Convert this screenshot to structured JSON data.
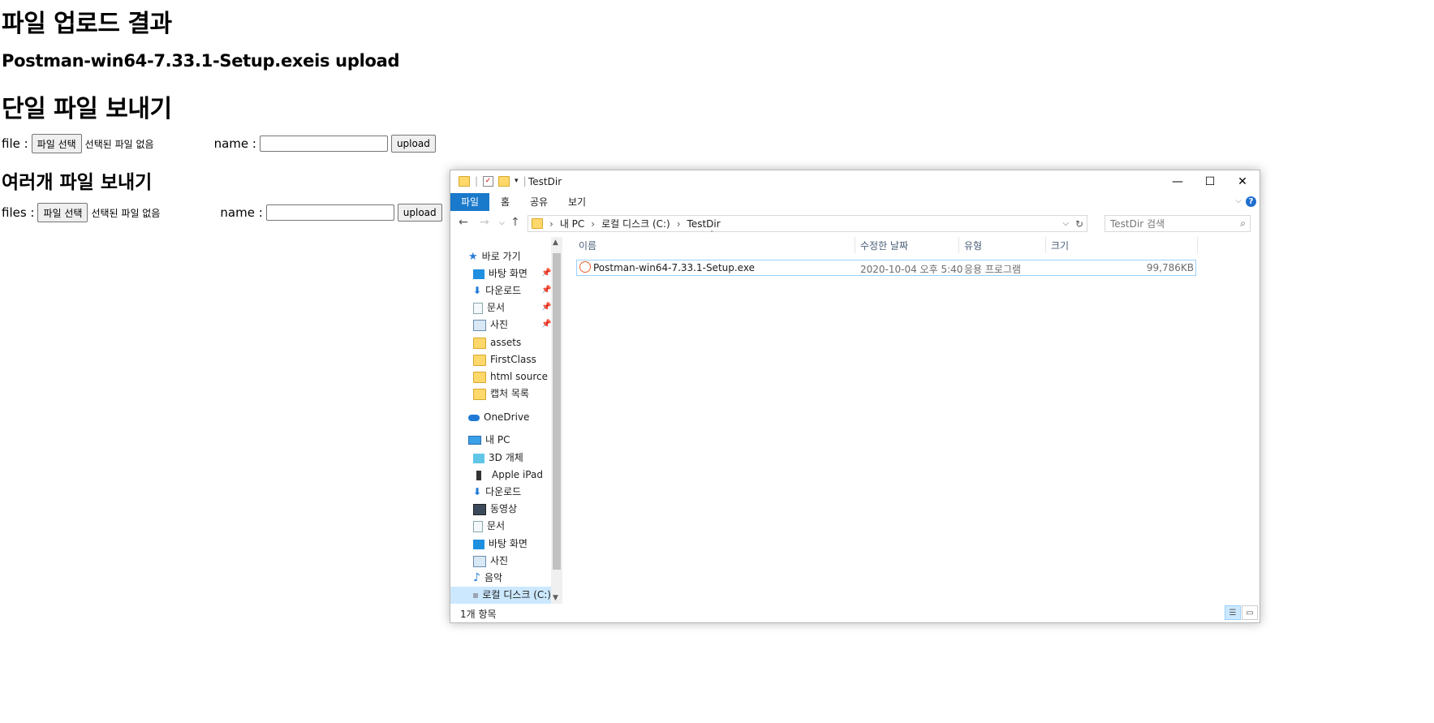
{
  "page": {
    "title": "파일 업로드 결과",
    "result": "Postman-win64-7.33.1-Setup.exeis upload",
    "single": {
      "heading": "단일 파일 보내기",
      "file_label": "file :",
      "file_button": "파일 선택",
      "no_file": "선택된 파일 없음",
      "name_label": "name :",
      "name_value": "",
      "submit": "upload"
    },
    "multi": {
      "heading": "여러개 파일 보내기",
      "file_label": "files :",
      "file_button": "파일 선택",
      "no_file": "선택된 파일 없음",
      "name_label": "name :",
      "name_value": "",
      "submit": "upload"
    }
  },
  "explorer": {
    "title": "TestDir",
    "ribbon_tabs": [
      "파일",
      "홈",
      "공유",
      "보기"
    ],
    "help": "?",
    "breadcrumb": [
      "내 PC",
      "로컬 디스크 (C:)",
      "TestDir"
    ],
    "search_placeholder": "TestDir 검색",
    "nav": {
      "quick_access": "바로 가기",
      "quick_items": [
        "바탕 화면",
        "다운로드",
        "문서",
        "사진",
        "assets",
        "FirstClass",
        "html source",
        "캡처 목록"
      ],
      "onedrive": "OneDrive",
      "this_pc": "내 PC",
      "pc_items": [
        "3D 개체",
        "Apple iPad",
        "다운로드",
        "동영상",
        "문서",
        "바탕 화면",
        "사진",
        "음악",
        "로컬 디스크 (C:)"
      ]
    },
    "columns": [
      "이름",
      "수정한 날짜",
      "유형",
      "크기"
    ],
    "files": [
      {
        "name": "Postman-win64-7.33.1-Setup.exe",
        "modified": "2020-10-04 오후 5:40",
        "type": "응용 프로그램",
        "size": "99,786KB"
      }
    ],
    "status": "1개 항목",
    "accent": "#1979ca"
  }
}
